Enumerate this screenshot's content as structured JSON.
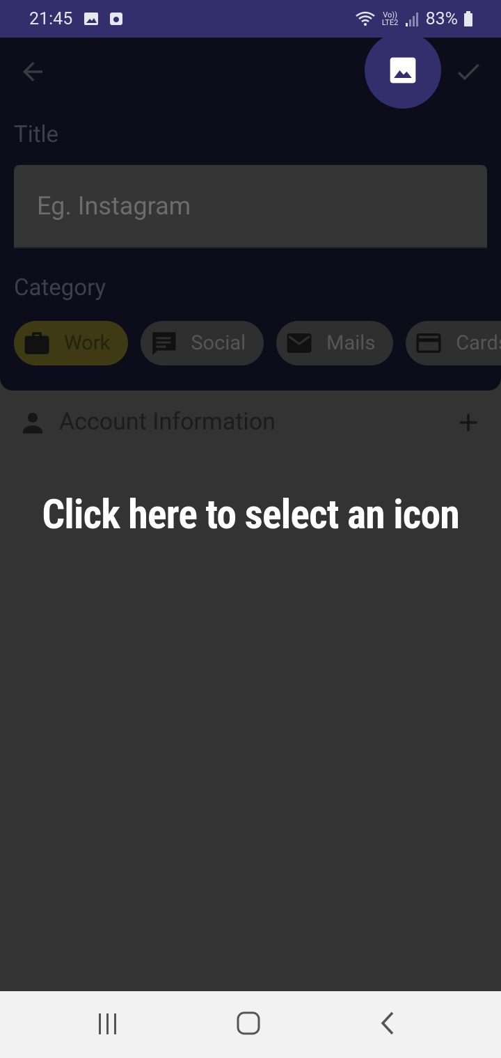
{
  "status_bar": {
    "time": "21:45",
    "network_label": "Vo)) LTE2",
    "battery": "83%"
  },
  "toolbar": {
    "back_icon": "arrow-left-icon",
    "image_icon": "image-icon",
    "save_icon": "check-icon"
  },
  "form": {
    "title_label": "Title",
    "title_placeholder": "Eg. Instagram",
    "category_label": "Category",
    "categories": [
      {
        "label": "Work",
        "icon": "briefcase-icon",
        "selected": true
      },
      {
        "label": "Social",
        "icon": "chat-icon",
        "selected": false
      },
      {
        "label": "Mails",
        "icon": "mail-icon",
        "selected": false
      },
      {
        "label": "Cards",
        "icon": "card-icon",
        "selected": false
      }
    ]
  },
  "account": {
    "label": "Account Information",
    "icon": "person-icon",
    "add_icon": "plus-icon"
  },
  "hint": {
    "text": "Click here to select an icon"
  },
  "colors": {
    "accent": "#332e6c",
    "overlay_bg": "#333333",
    "card_bg": "#0c0c1a",
    "chip_selected": "#3d3a14"
  }
}
